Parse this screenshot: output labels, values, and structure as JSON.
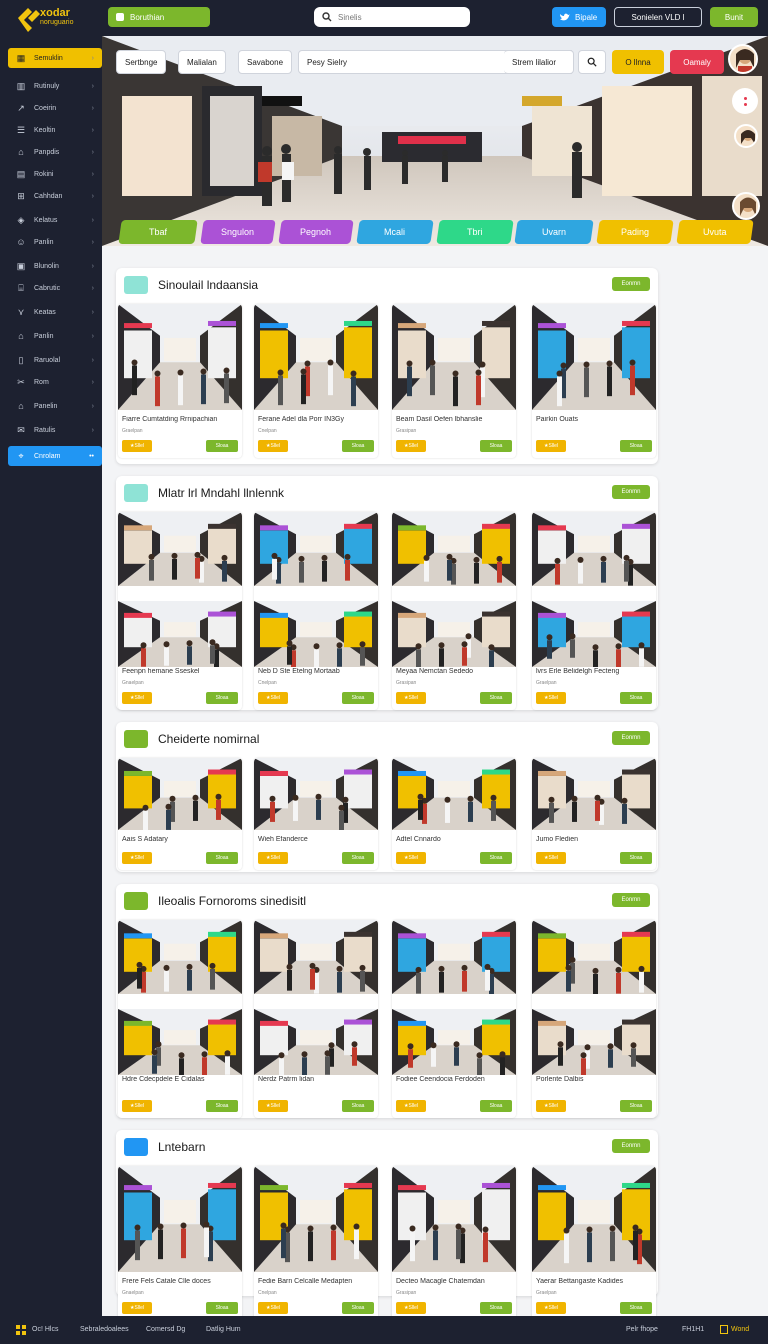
{
  "colors": {
    "dark": "#1d2130",
    "green": "#7cb72c",
    "yellow": "#f0b400",
    "blue": "#2196f3",
    "red": "#e53950"
  },
  "topbar": {
    "logo_line1": "xodar",
    "logo_line2": "noruguario",
    "green_pill": "Boruthian",
    "search_placeholder": "Sinelis",
    "twitter_btn": "Bipale",
    "outline_btn": "Sonielen VLD l",
    "right_btn": "Bunit"
  },
  "sidebar": {
    "items": [
      {
        "label": "Semuklin",
        "icon": "grid-icon"
      },
      {
        "label": "Rutinuly",
        "icon": "chart-icon"
      },
      {
        "label": "Coeirin",
        "icon": "arrow-icon"
      },
      {
        "label": "Keoltin",
        "icon": "list-icon"
      },
      {
        "label": "Panpdis",
        "icon": "shop-icon"
      },
      {
        "label": "Rokini",
        "icon": "book-icon"
      },
      {
        "label": "Cahhdan",
        "icon": "cart-icon"
      },
      {
        "label": "Kelatus",
        "icon": "tag-icon"
      },
      {
        "label": "Panlin",
        "icon": "user-icon"
      },
      {
        "label": "Blunolin",
        "icon": "box-icon"
      },
      {
        "label": "Cabrutic",
        "icon": "building-icon"
      },
      {
        "label": "Keatas",
        "icon": "filter-icon"
      },
      {
        "label": "Panlin",
        "icon": "home-icon"
      },
      {
        "label": "Raruolal",
        "icon": "note-icon"
      },
      {
        "label": "Rom",
        "icon": "scissors-icon"
      },
      {
        "label": "Panelin",
        "icon": "shop-icon"
      },
      {
        "label": "Ratulis",
        "icon": "mail-icon"
      },
      {
        "label": "Cnrolam",
        "icon": "location-icon"
      }
    ]
  },
  "hero": {
    "filters": [
      "Sertbnge",
      "Malialan",
      "Savabone",
      "Pesy Sielry",
      "Strem lilalior"
    ],
    "btn_yellow": "O llnna",
    "btn_red": "Oamaly",
    "categories": [
      {
        "label": "Tbaf",
        "color": "#7cb72c"
      },
      {
        "label": "Sngulon",
        "color": "#ab52d6"
      },
      {
        "label": "Pegnoh",
        "color": "#ab52d6"
      },
      {
        "label": "Mcali",
        "color": "#2fa6e0"
      },
      {
        "label": "Tbri",
        "color": "#2ed889"
      },
      {
        "label": "Uvarn",
        "color": "#2fa6e0"
      },
      {
        "label": "Pading",
        "color": "#f0c000"
      },
      {
        "label": "Uvuta",
        "color": "#f0c000"
      }
    ]
  },
  "sections": [
    {
      "title": "Sinoulail lndaansia",
      "icon_color": "#8fe3d6",
      "btn": "Eonmn",
      "cards": [
        {
          "title": "Fiarre Cumtatding Rrnipachian",
          "sub": "Graelpan",
          "tag": "Sllel",
          "btn": "Sloaa"
        },
        {
          "title": "Ferane Adel dla Porr IN3Gy",
          "sub": "Cnelpan",
          "tag": "Sllel",
          "btn": "Sloaa"
        },
        {
          "title": "Beam Dasil Oefen lbhanslie",
          "sub": "Grasipan",
          "tag": "Sllel",
          "btn": "Sloaa"
        },
        {
          "title": "Pairkin Ouats",
          "sub": "",
          "tag": "Sllel",
          "btn": "Sloaa"
        }
      ]
    },
    {
      "title": "Mlatr lrl Mndahl llnlennk",
      "icon_color": "#8fe3d6",
      "btn": "Eonmn",
      "cards": [
        {
          "title": "Feenpn hemane Sseskel",
          "sub": "Gnaelpan",
          "tag": "Sllel",
          "btn": "Sloaa"
        },
        {
          "title": "Neb D Ste Etelng Mortaab",
          "sub": "Cnelpan",
          "tag": "Sllel",
          "btn": "Sloaa"
        },
        {
          "title": "Meyaa Nemctan Sededo",
          "sub": "Grasipan",
          "tag": "Sllel",
          "btn": "Sloaa"
        },
        {
          "title": "lvrs Erle Belidelgh Fecteng",
          "sub": "Graelpan",
          "tag": "Sllel",
          "btn": "Sloaa"
        }
      ]
    },
    {
      "title": "Cheiderte nomirnal",
      "icon_color": "#7cb72c",
      "btn": "Eonmn",
      "cards": [
        {
          "title": "Aais S Adatary",
          "sub": "",
          "tag": "Sllel",
          "btn": "Sloaa"
        },
        {
          "title": "Wieh Efanderce",
          "sub": "",
          "tag": "Sllel",
          "btn": "Sloaa"
        },
        {
          "title": "Adtel Cnnardo",
          "sub": "",
          "tag": "Sllel",
          "btn": "Sloaa"
        },
        {
          "title": "Jumo Fledien",
          "sub": "",
          "tag": "Sllel",
          "btn": "Sloaa"
        }
      ]
    },
    {
      "title": "Ileoalis Fornoroms sinedisitl",
      "icon_color": "#7cb72c",
      "btn": "Eonmn",
      "cards": [
        {
          "title": "Hdre Cdecpdele E Cidalas",
          "sub": "",
          "tag": "Sllel",
          "btn": "Sloaa"
        },
        {
          "title": "Nerdz Patrm lidan",
          "sub": "",
          "tag": "Sllel",
          "btn": "Sloaa"
        },
        {
          "title": "Fodiee Ceendocia Ferdoden",
          "sub": "",
          "tag": "Sllel",
          "btn": "Sloaa"
        },
        {
          "title": "Porlente Dalbis",
          "sub": "",
          "tag": "Sllel",
          "btn": "Sloaa"
        }
      ]
    },
    {
      "title": "Lntebarn",
      "icon_color": "#2196f3",
      "btn": "Eonmn",
      "cards": [
        {
          "title": "Frere Fels Catale Clle doces",
          "sub": "Gnaelpan",
          "tag": "Sllel",
          "btn": "Sloaa"
        },
        {
          "title": "Fedie Barn Celcalle Medapten",
          "sub": "Cnelpan",
          "tag": "Sllel",
          "btn": "Sloaa"
        },
        {
          "title": "Decteo Macagle Chatemdan",
          "sub": "Grasipan",
          "tag": "Sllel",
          "btn": "Sloaa"
        },
        {
          "title": "Yaerar Bettangaste Kadides",
          "sub": "Graelpan",
          "tag": "Sllel",
          "btn": "Sloaa"
        }
      ]
    }
  ],
  "bottombar": {
    "left1": "Oc! Hlcs",
    "left2": "Sebraledoalees",
    "left3": "Comersd Dg",
    "left4": "Datlig Hum",
    "right1": "Pelr fhope",
    "right2": "FH1H1",
    "right3": "Wond"
  }
}
